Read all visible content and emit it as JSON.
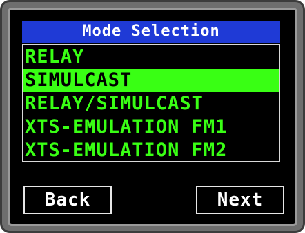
{
  "title": "Mode Selection",
  "modes": [
    {
      "label": "RELAY",
      "selected": false
    },
    {
      "label": "SIMULCAST",
      "selected": true
    },
    {
      "label": "RELAY/SIMULCAST",
      "selected": false
    },
    {
      "label": "XTS-EMULATION FM1",
      "selected": false
    },
    {
      "label": "XTS-EMULATION FM2",
      "selected": false
    }
  ],
  "buttons": {
    "back_label": "Back",
    "next_label": "Next"
  },
  "colors": {
    "title_bar": "#1f3ad6",
    "list_text": "#39ff14",
    "selection_highlight": "#39ff14",
    "screen_background": "#000000"
  }
}
